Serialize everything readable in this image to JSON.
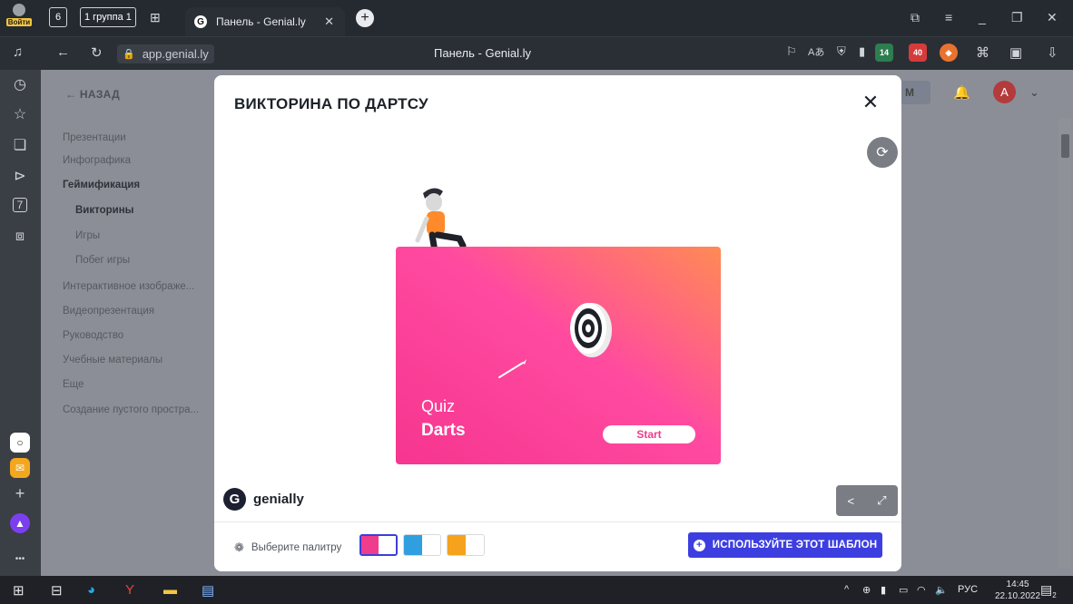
{
  "browser": {
    "login_label": "Войти",
    "tab_count": "6",
    "group_label": "1 группа 1",
    "active_tab_title": "Панель - Genial.ly",
    "address": "app.genial.ly",
    "page_title": "Панель - Genial.ly",
    "extensions": [
      {
        "name": "translate-icon",
        "text": "⛭"
      },
      {
        "name": "ext-14",
        "text": "14",
        "color": "#2e7d4f"
      },
      {
        "name": "ext-40",
        "text": "40",
        "color": "#d63b3b"
      },
      {
        "name": "ext-fox",
        "text": "🦊",
        "color": "#4a4f57"
      }
    ]
  },
  "left_rail": {
    "icons": [
      "bell-icon",
      "star-icon",
      "collections-icon",
      "play-icon",
      "tab-7-icon",
      "screenshot-icon"
    ],
    "tab_7_label": "7"
  },
  "sidebar": {
    "back_label": "← НАЗАД",
    "items": [
      {
        "label": "Презентации",
        "level": 0,
        "bold": false
      },
      {
        "label": "Инфографика",
        "level": 0,
        "bold": false
      },
      {
        "label": "Геймификация",
        "level": 0,
        "bold": true
      },
      {
        "label": "Викторины",
        "level": 1,
        "bold": true
      },
      {
        "label": "Игры",
        "level": 1,
        "bold": false
      },
      {
        "label": "Побег игры",
        "level": 1,
        "bold": false
      },
      {
        "label": "Интерактивное изображе...",
        "level": 0,
        "bold": false
      },
      {
        "label": "Видеопрезентация",
        "level": 0,
        "bold": false
      },
      {
        "label": "Руководство",
        "level": 0,
        "bold": false
      },
      {
        "label": "Учебные материалы",
        "level": 0,
        "bold": false
      },
      {
        "label": "Еще",
        "level": 0,
        "bold": false
      },
      {
        "label": "Создание пустого простра...",
        "level": 0,
        "bold": false
      }
    ]
  },
  "header_right": {
    "partial_button": "М",
    "avatar_letter": "A"
  },
  "modal": {
    "title": "ВИКТОРИНА ПО ДАРТСУ",
    "card": {
      "line1": "Quiz",
      "line2": "Darts",
      "start_label": "Start"
    },
    "logo_text": "genially",
    "palette_label": "Выберите палитру",
    "palettes": [
      {
        "left": "#ef3d8e",
        "right": "#ffffff",
        "selected": true
      },
      {
        "left": "#2f9fe0",
        "right": "#ffffff",
        "selected": false
      },
      {
        "left": "#f5a21c",
        "right": "#ffffff",
        "selected": false
      }
    ],
    "use_button_label": "ИСПОЛЬЗУЙТЕ ЭТОТ ШАБЛОН"
  },
  "taskbar": {
    "lang": "РУС",
    "time": "14:45",
    "date": "22.10.2022",
    "notif_count": "2"
  }
}
